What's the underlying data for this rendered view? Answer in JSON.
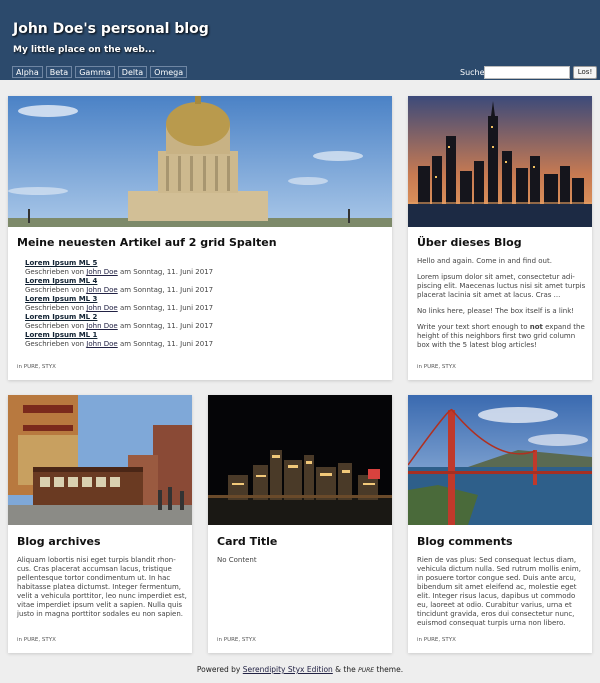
{
  "header": {
    "title": "John Doe's personal blog",
    "tagline": "My little place on the web...",
    "nav": [
      "Alpha",
      "Beta",
      "Gamma",
      "Delta",
      "Omega"
    ],
    "search_label": "Suche",
    "search_value": "",
    "search_button": "Los!"
  },
  "cards": {
    "latest": {
      "title": "Meine neuesten Artikel auf 2 grid Spalten",
      "posts": [
        {
          "title": "Lorem Ipsum ML 5",
          "meta_prefix": "Geschrieben von ",
          "author": "John Doe",
          "meta_suffix": " am Sonntag, 11. Juni 2017"
        },
        {
          "title": "Lorem Ipsum ML 4",
          "meta_prefix": "Geschrieben von ",
          "author": "John Doe",
          "meta_suffix": " am Sonntag, 11. Juni 2017"
        },
        {
          "title": "Lorem Ipsum ML 3",
          "meta_prefix": "Geschrieben von ",
          "author": "John Doe",
          "meta_suffix": " am Sonntag, 11. Juni 2017"
        },
        {
          "title": "Lorem Ipsum ML 2",
          "meta_prefix": "Geschrieben von ",
          "author": "John Doe",
          "meta_suffix": " am Sonntag, 11. Juni 2017"
        },
        {
          "title": "Lorem Ipsum ML 1",
          "meta_prefix": "Geschrieben von ",
          "author": "John Doe",
          "meta_suffix": " am Sonntag, 11. Juni 2017"
        }
      ],
      "footer": "in PURE, STYX"
    },
    "about": {
      "title": "Über dieses Blog",
      "p1": "Hello and again. Come in and find out.",
      "p2": "Lorem ipsum dolor sit amet, consectetur adi­piscing elit. Maecenas luctus nisi sit amet tur­pis placerat lacinia sit amet at lacus. Cras ...",
      "p3": "No links here, please! The box itself is a link!",
      "p4_a": "Write your text short enough to ",
      "p4_bold": "not",
      "p4_b": " expand the height of this neighbors first two grid co­lumn box with the 5 latest blog articles!",
      "footer": "in PURE, STYX"
    },
    "archives": {
      "title": "Blog archives",
      "body": "Aliquam lobortis nisi eget turpis blandit rhon­cus. Cras placerat accumsan lacus, tristique pellentesque tortor condimentum ut. In hac habitasse platea dictumst. Integer fermentum, velit a vehicula porttitor, leo nunc imperdiet est, vitae imperdiet ipsum velit a sapien. Nulla quis justo in magna porttitor sodales eu non sapien.",
      "footer": "in PURE, STYX"
    },
    "card": {
      "title": "Card Title",
      "body": "No Content",
      "footer": "in PURE, STYX"
    },
    "comments": {
      "title": "Blog comments",
      "body": "Rien de vas plus: Sed consequat lectus diam, vehicula dictum nulla. Sed rutrum mollis enim, in posuere tortor congue sed. Duis ante arcu, bibendum sit amet eleifend ac, molestie eget elit. Integer risus lacus, dapibus ut commodo eu, laoreet at odio. Curabitur varius, urna et tincidunt gravida, eros dui consectetur nunc, euismod consequat turpis urna non libero.",
      "footer": "in PURE, STYX"
    }
  },
  "footer": {
    "prefix": "Powered by ",
    "link": "Serendipity Styx Edition",
    "middle": " & the ",
    "theme": "PURE",
    "suffix": " theme."
  },
  "colors": {
    "header_bg": "#2c4a6c",
    "page_bg": "#eeeeee"
  }
}
